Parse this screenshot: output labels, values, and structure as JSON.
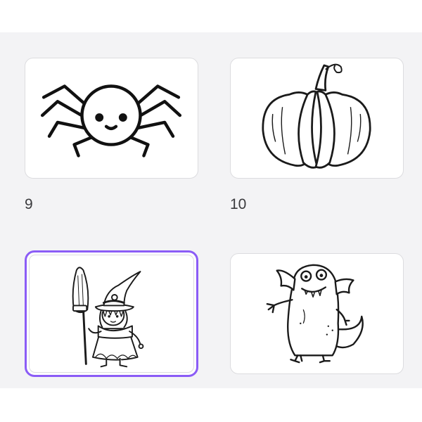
{
  "grid": {
    "items": [
      {
        "number": "9",
        "picture": "spider-icon"
      },
      {
        "number": "10",
        "picture": "pumpkin-icon"
      },
      {
        "number": "",
        "picture": "witch-icon",
        "selected": true
      },
      {
        "number": "",
        "picture": "monster-icon"
      }
    ]
  },
  "colors": {
    "background": "#f3f3f5",
    "selection": "#8b5cf6",
    "card_border": "#dcdcdf"
  }
}
